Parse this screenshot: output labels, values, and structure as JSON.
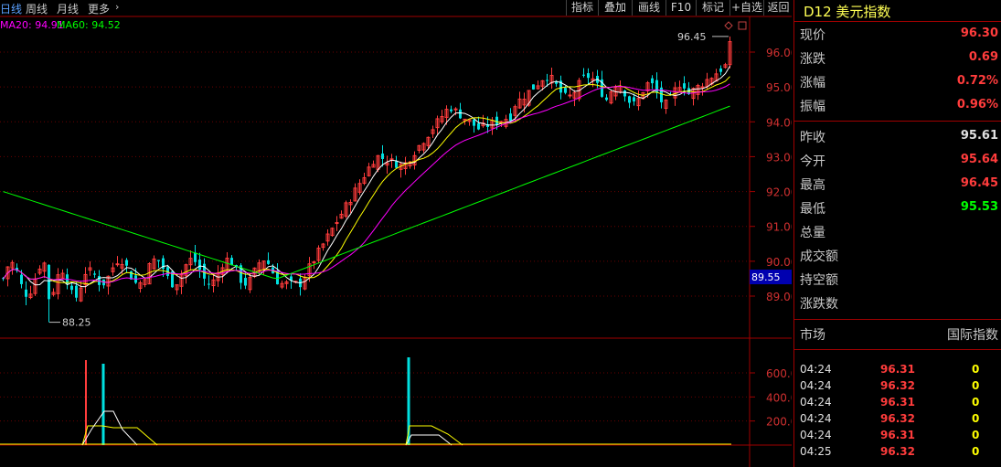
{
  "top_tabs": [
    {
      "label": "日线",
      "active": true
    },
    {
      "label": "周线",
      "active": false
    },
    {
      "label": "月线",
      "active": false
    },
    {
      "label": "更多",
      "active": false
    }
  ],
  "toolbar": [
    "指标",
    "叠加",
    "画线",
    "F10",
    "标记",
    "+自选",
    "返回"
  ],
  "legend": {
    "ma20": "MA20: 94.91",
    "ma60": "MA60: 94.52"
  },
  "price_axis": [
    "96.00",
    "95.00",
    "94.00",
    "93.00",
    "92.00",
    "91.00",
    "90.00",
    "89.00"
  ],
  "current_price_marker": "89.55",
  "high_marker": "96.45",
  "low_marker": "88.25",
  "volume_axis": [
    "600.0",
    "400.0",
    "200.0"
  ],
  "colors": {
    "up": "#ff3c3c",
    "down": "#00e0e0",
    "ma5": "#ffffff",
    "ma10": "#ffff00",
    "ma20": "#ff00ff",
    "ma60": "#00ff00",
    "border": "#a00000"
  },
  "panel": {
    "title": "D12 美元指数",
    "quote": [
      {
        "label": "现价",
        "value": "96.30",
        "color": "#ff3c3c"
      },
      {
        "label": "涨跌",
        "value": "0.69",
        "color": "#ff3c3c"
      },
      {
        "label": "涨幅",
        "value": "0.72%",
        "color": "#ff3c3c"
      },
      {
        "label": "振幅",
        "value": "0.96%",
        "color": "#ff3c3c"
      }
    ],
    "stats": [
      {
        "label": "昨收",
        "value": "95.61",
        "color": "#e0e0e0"
      },
      {
        "label": "今开",
        "value": "95.64",
        "color": "#ff3c3c"
      },
      {
        "label": "最高",
        "value": "96.45",
        "color": "#ff3c3c"
      },
      {
        "label": "最低",
        "value": "95.53",
        "color": "#00ff00"
      },
      {
        "label": "总量",
        "value": "",
        "color": "#e0e0e0"
      },
      {
        "label": "成交额",
        "value": "",
        "color": "#e0e0e0"
      },
      {
        "label": "持空额",
        "value": "",
        "color": "#e0e0e0"
      },
      {
        "label": "涨跌数",
        "value": "",
        "color": "#e0e0e0"
      }
    ],
    "market_label": "市场",
    "market_value": "国际指数",
    "ticks": [
      {
        "time": "04:24",
        "price": "96.31",
        "vol": "0"
      },
      {
        "time": "04:24",
        "price": "96.32",
        "vol": "0"
      },
      {
        "time": "04:24",
        "price": "96.31",
        "vol": "0"
      },
      {
        "time": "04:24",
        "price": "96.32",
        "vol": "0"
      },
      {
        "time": "04:24",
        "price": "96.31",
        "vol": "0"
      },
      {
        "time": "04:25",
        "price": "96.32",
        "vol": "0"
      }
    ]
  }
}
